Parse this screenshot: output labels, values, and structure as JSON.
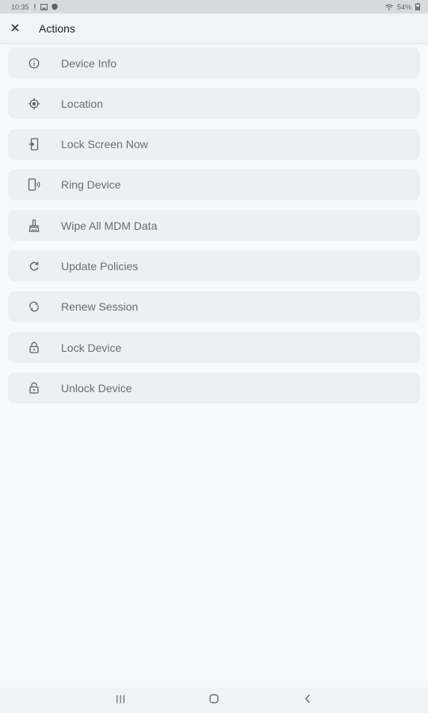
{
  "status_bar": {
    "time": "10:35",
    "battery": "54%"
  },
  "toolbar": {
    "title": "Actions"
  },
  "actions": [
    {
      "label": "Device Info",
      "icon": "info-icon"
    },
    {
      "label": "Location",
      "icon": "location-icon"
    },
    {
      "label": "Lock Screen Now",
      "icon": "lock-screen-icon"
    },
    {
      "label": "Ring Device",
      "icon": "ring-device-icon"
    },
    {
      "label": "Wipe All MDM Data",
      "icon": "wipe-icon"
    },
    {
      "label": "Update Policies",
      "icon": "refresh-icon"
    },
    {
      "label": "Renew Session",
      "icon": "sync-icon"
    },
    {
      "label": "Lock Device",
      "icon": "lock-icon"
    },
    {
      "label": "Unlock Device",
      "icon": "unlock-icon"
    }
  ],
  "colors": {
    "background": "#f8f9fa",
    "item_background": "#eeeff1",
    "label": "#6a6d71",
    "status_bar": "#d9dadc"
  }
}
